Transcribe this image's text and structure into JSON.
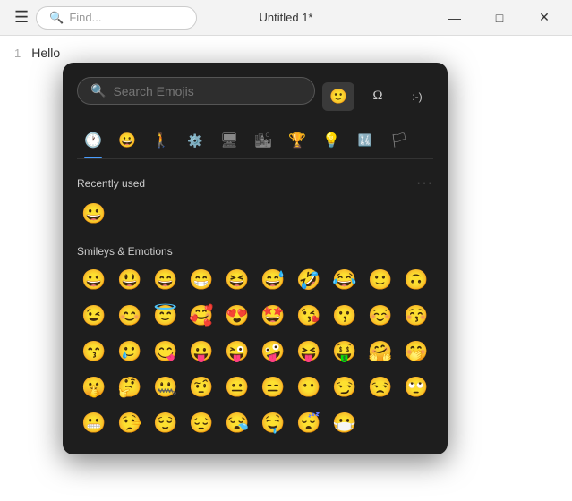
{
  "titleBar": {
    "title": "Untitled 1*",
    "searchPlaceholder": "Find...",
    "menuIcon": "☰",
    "minimizeIcon": "—",
    "maximizeIcon": "□",
    "closeIcon": "✕"
  },
  "editor": {
    "lineNumber": "1",
    "lineContent": "Hello"
  },
  "emojiPicker": {
    "searchPlaceholder": "Search Emojis",
    "typeTabs": [
      {
        "id": "emoji",
        "label": "🙂",
        "active": true
      },
      {
        "id": "symbol",
        "label": "Ω",
        "active": false
      },
      {
        "id": "kaomoji",
        "label": ":-)",
        "active": false
      }
    ],
    "categories": [
      {
        "id": "recent",
        "icon": "🕐",
        "active": true
      },
      {
        "id": "smileys",
        "icon": "😀",
        "active": false
      },
      {
        "id": "people",
        "icon": "🚶",
        "active": false
      },
      {
        "id": "activities",
        "icon": "⚙️",
        "active": false
      },
      {
        "id": "technology",
        "icon": "🖥",
        "active": false
      },
      {
        "id": "places",
        "icon": "🏙",
        "active": false
      },
      {
        "id": "awards",
        "icon": "🏆",
        "active": false
      },
      {
        "id": "objects",
        "icon": "💡",
        "active": false
      },
      {
        "id": "symbols",
        "icon": "🔣",
        "active": false
      },
      {
        "id": "flags",
        "icon": "🏳",
        "active": false
      }
    ],
    "sections": [
      {
        "label": "Recently used",
        "hasMore": true,
        "emojis": [
          "😀"
        ]
      },
      {
        "label": "Smileys & Emotions",
        "hasMore": false,
        "emojis": [
          "😀",
          "😃",
          "😄",
          "😁",
          "😆",
          "😅",
          "🤣",
          "😂",
          "🙂",
          "🙃",
          "😉",
          "😊",
          "😇",
          "🥰",
          "😍",
          "🤩",
          "😘",
          "😗",
          "☺️",
          "😚",
          "😙",
          "🥲",
          "😋",
          "😛",
          "😜",
          "🤪",
          "😝",
          "🤑",
          "🤗",
          "🤭",
          "🤫",
          "🤔",
          "🤐",
          "🤨",
          "😐",
          "😑",
          "😶",
          "😏",
          "😒",
          "🙄",
          "😬",
          "🤥",
          "😌",
          "😔",
          "😪",
          "🤤",
          "😴",
          "😷"
        ]
      }
    ],
    "moreIcon": "···"
  }
}
